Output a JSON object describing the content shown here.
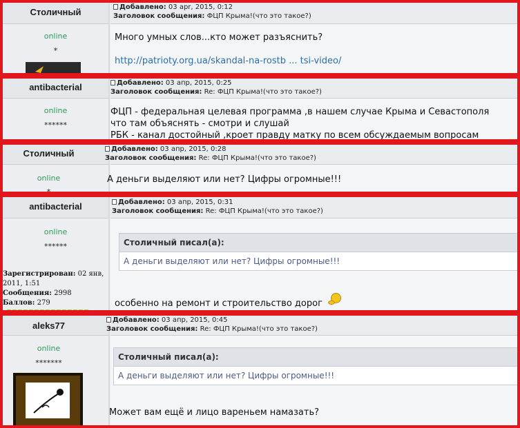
{
  "posts": [
    {
      "author": "Столичный",
      "added_label": "Добавлено:",
      "date": "03 apr, 2015, 0:12",
      "subject_label": "Заголовок сообщения:",
      "subject": "ФЦП Крыма!(что это такое?)",
      "status": "online",
      "rank": "*",
      "text_lines": [
        "Много умных слов...кто может разъяснить?"
      ],
      "link": "http://patrioty.org.ua/skandal-na-rostb ... tsi-video/"
    },
    {
      "author": "antibacterial",
      "added_label": "Добавлено:",
      "date": "03 апр, 2015, 0:25",
      "subject_label": "Заголовок сообщения:",
      "subject": "Re: ФЦП Крыма!(что это такое?)",
      "status": "online",
      "rank": "******",
      "text_lines": [
        "ФЦП - федеральная целевая программа ,в нашем случае Крыма и Севастополя",
        "что там объяснять - смотри и слушай",
        "РБК - канал достойный ,кроет правду матку по всем обсуждаемым вопросам"
      ]
    },
    {
      "author": "Столичный",
      "added_label": "Добавлено:",
      "date": "03 апр, 2015, 0:28",
      "subject_label": "Заголовок сообщения:",
      "subject": "Re: ФЦП Крыма!(что это такое?)",
      "status": "online",
      "rank": "*",
      "text_lines": [
        "А деньги выделяют или нет? Цифры огромные!!!"
      ]
    },
    {
      "author": "antibacterial",
      "added_label": "Добавлено:",
      "date": "03 апр, 2015, 0:31",
      "subject_label": "Заголовок сообщения:",
      "subject": "Re: ФЦП Крыма!(что это такое?)",
      "status": "online",
      "rank": "******",
      "quote_title": "Столичный писал(а):",
      "quote_text": "А деньги выделяют или нет? Цифры огромные!!!",
      "text_lines": [
        "особенно на ремонт и строительство дорог"
      ],
      "stats": {
        "registered_label": "Зарегистрирован:",
        "registered_value_1": "02 янв,",
        "registered_value_2": "2011, 1:51",
        "messages_label": "Сообщения:",
        "messages_value": "2998",
        "points_label": "Баллов:",
        "points_value": "279"
      }
    },
    {
      "author": "aleks77",
      "added_label": "Добавлено:",
      "date": "03 апр, 2015, 0:45",
      "subject_label": "Заголовок сообщения:",
      "subject": "Re: ФЦП Крыма!(что это такое?)",
      "status": "online",
      "rank": "*******",
      "quote_title": "Столичный писал(а):",
      "quote_text": "А деньги выделяют или нет? Цифры огромные!!!",
      "text_lines": [
        "Может вам ещё и лицо вареньем намазать?"
      ]
    }
  ],
  "colors": {
    "highlight_border": "#e2161d",
    "online": "#2f9c57",
    "link": "#2b6ea8",
    "quote_text": "#4b5a86"
  }
}
